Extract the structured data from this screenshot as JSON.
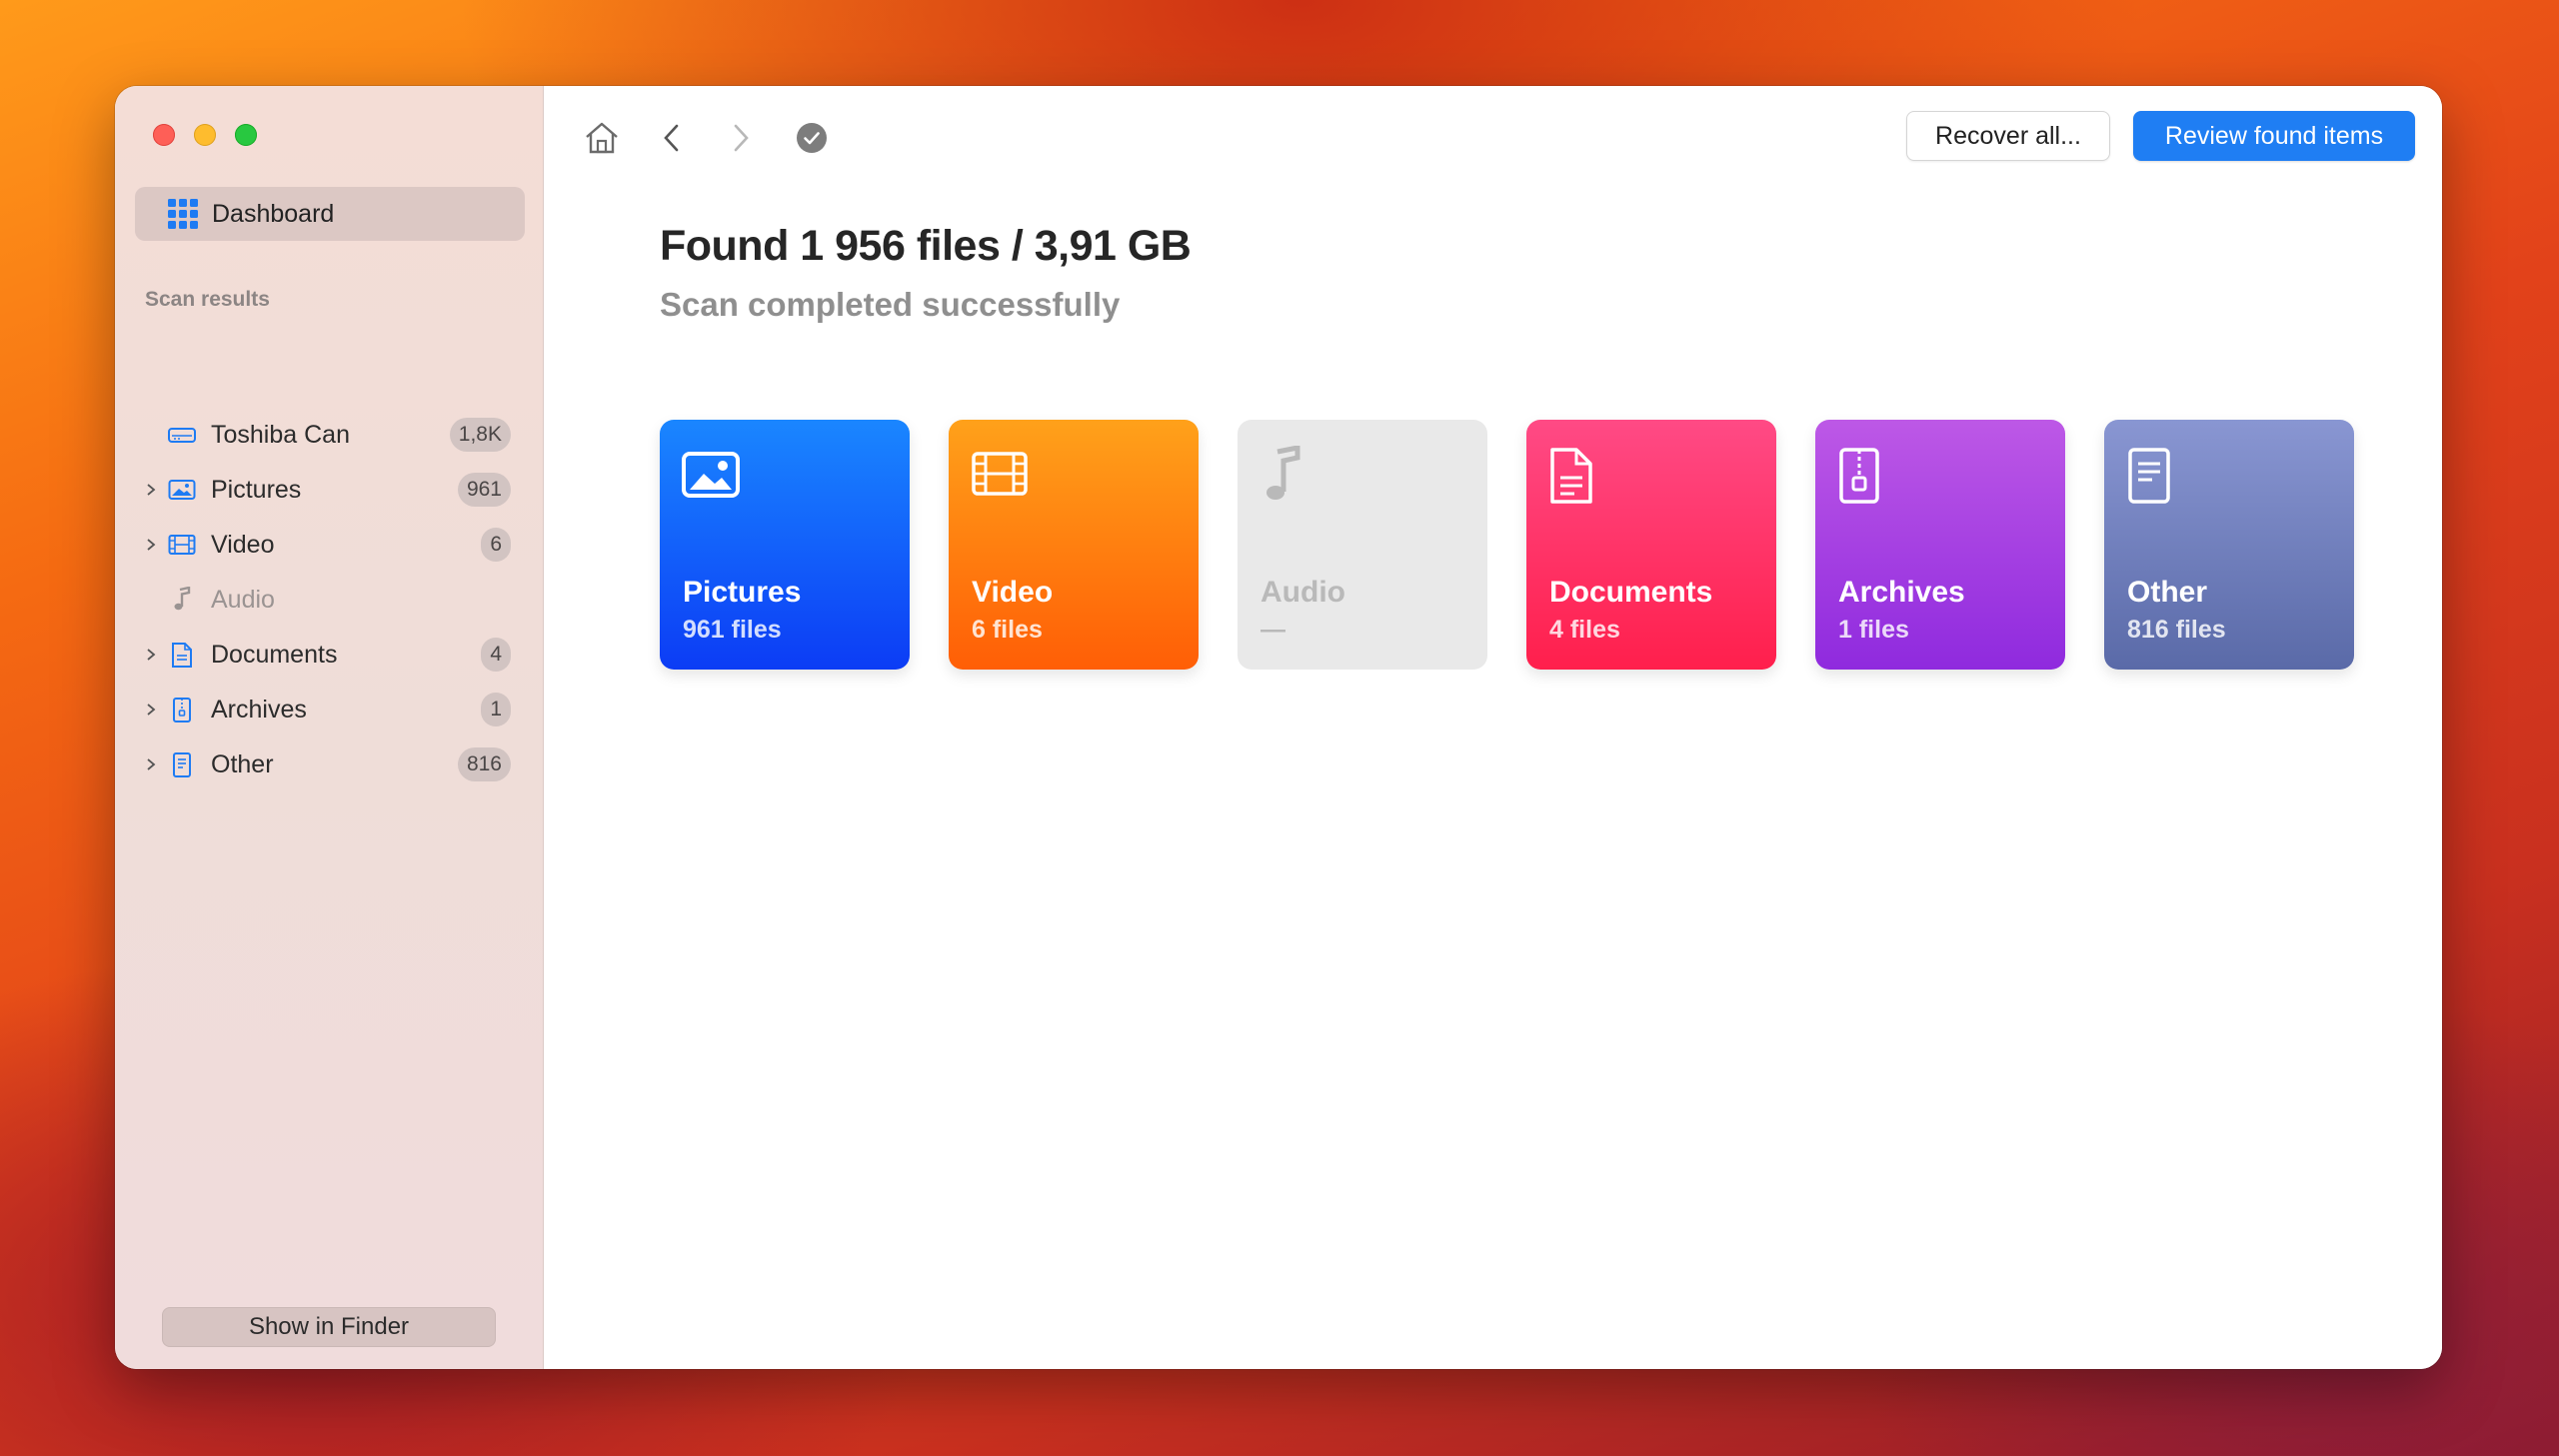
{
  "sidebar": {
    "dashboard_label": "Dashboard",
    "section_label": "Scan results",
    "items": [
      {
        "label": "Toshiba Can",
        "count": "1,8K"
      },
      {
        "label": "Pictures",
        "count": "961"
      },
      {
        "label": "Video",
        "count": "6"
      },
      {
        "label": "Audio",
        "count": ""
      },
      {
        "label": "Documents",
        "count": "4"
      },
      {
        "label": "Archives",
        "count": "1"
      },
      {
        "label": "Other",
        "count": "816"
      }
    ],
    "show_in_finder_label": "Show in Finder"
  },
  "toolbar": {
    "recover_all_label": "Recover all...",
    "review_label": "Review found items"
  },
  "main": {
    "title": "Found 1 956 files / 3,91 GB",
    "subtitle": "Scan completed successfully",
    "cards": [
      {
        "name": "Pictures",
        "count": "961 files",
        "icon": "picture-icon"
      },
      {
        "name": "Video",
        "count": "6 files",
        "icon": "film-icon"
      },
      {
        "name": "Audio",
        "count": "—",
        "icon": "music-note-icon"
      },
      {
        "name": "Documents",
        "count": "4 files",
        "icon": "document-icon"
      },
      {
        "name": "Archives",
        "count": "1 files",
        "icon": "archive-icon"
      },
      {
        "name": "Other",
        "count": "816 files",
        "icon": "other-file-icon"
      }
    ]
  },
  "colors": {
    "accent": "#1f7ef3",
    "pictures": "#0c3cf5",
    "video": "#ff5e06",
    "audio": "#e9e9e9",
    "documents": "#ff1f4c",
    "archives": "#8f2ade",
    "other": "#5a6aa8"
  }
}
